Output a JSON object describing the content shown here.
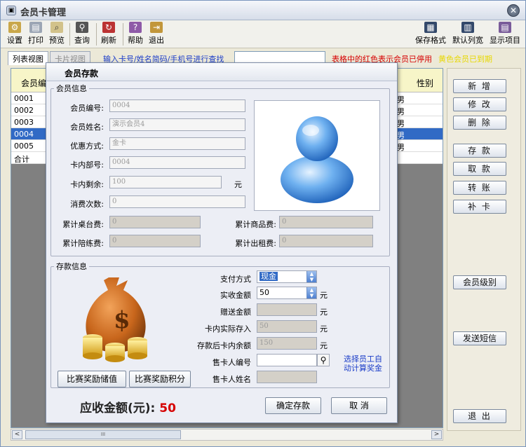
{
  "window": {
    "title": "会员卡管理",
    "app_icon": "card-icon",
    "close_symbol": "✕"
  },
  "toolbar": {
    "settings": "设置",
    "print": "打印",
    "preview": "预览",
    "query": "查询",
    "refresh": "刷新",
    "help": "帮助",
    "exit": "退出",
    "save_format": "保存格式",
    "default_width": "默认列宽",
    "show_items": "显示项目"
  },
  "tabs": {
    "list_view": "列表视图",
    "card_view": "卡片视图"
  },
  "search": {
    "label": "输入卡号/姓名简码/手机号进行查找",
    "value": ""
  },
  "legend": {
    "red_text": "表格中的红色表示会员已停用",
    "yellow_text": "黄色会员已到期"
  },
  "grid": {
    "col_id": "会员编",
    "col_sex": "性别",
    "rows": [
      {
        "id": "0001",
        "sex": "男",
        "selected": false
      },
      {
        "id": "0002",
        "sex": "男",
        "selected": false
      },
      {
        "id": "0003",
        "sex": "男",
        "selected": false
      },
      {
        "id": "0004",
        "sex": "男",
        "selected": true
      },
      {
        "id": "0005",
        "sex": "男",
        "selected": false
      },
      {
        "id": "合计",
        "sex": "",
        "selected": false
      }
    ],
    "scroll_thumb": "III",
    "scroll_left": "<",
    "scroll_right": ">"
  },
  "right_buttons": {
    "add": "新 增",
    "edit": "修 改",
    "delete": "删 除",
    "deposit": "存 款",
    "withdraw": "取 款",
    "transfer": "转 账",
    "reissue": "补 卡",
    "level": "会员级别",
    "sms": "发送短信",
    "exit": "退 出"
  },
  "dialog": {
    "title": "会员存款",
    "member_group": "会员信息",
    "member_no_label": "会员编号:",
    "member_no": "0004",
    "member_name_label": "会员姓名:",
    "member_name": "演示会员4",
    "discount_label": "优惠方式:",
    "discount": "金卡",
    "card_code_label": "卡内部号:",
    "card_code": "0004",
    "balance_label": "卡内剩余:",
    "balance": "100",
    "balance_unit": "元",
    "visits_label": "消费次数:",
    "visits": "0",
    "table_fee_label": "累计桌台费:",
    "table_fee": "0",
    "goods_fee_label": "累计商品费:",
    "goods_fee": "0",
    "accompany_fee_label": "累计陪练费:",
    "accompany_fee": "0",
    "rent_fee_label": "累计出租费:",
    "rent_fee": "0",
    "deposit_group": "存款信息",
    "pay_method_label": "支付方式",
    "pay_method": "现金",
    "received_label": "实收金额",
    "received": "50",
    "received_unit": "元",
    "gift_label": "赠送金额",
    "gift": "",
    "gift_unit": "元",
    "actual_label": "卡内实际存入",
    "actual": "50",
    "actual_unit": "元",
    "after_label": "存款后卡内余额",
    "after": "150",
    "after_unit": "元",
    "seller_no_label": "售卡人编号",
    "seller_no": "",
    "seller_name_label": "售卡人姓名",
    "seller_name": "",
    "hint": "选择员工自动计算奖金",
    "reward_value_btn": "比赛奖励储值",
    "reward_points_btn": "比赛奖励积分",
    "total_label": "应收金额(元):",
    "total_value": "50",
    "confirm_btn": "确定存款",
    "cancel_btn": "取 消"
  }
}
